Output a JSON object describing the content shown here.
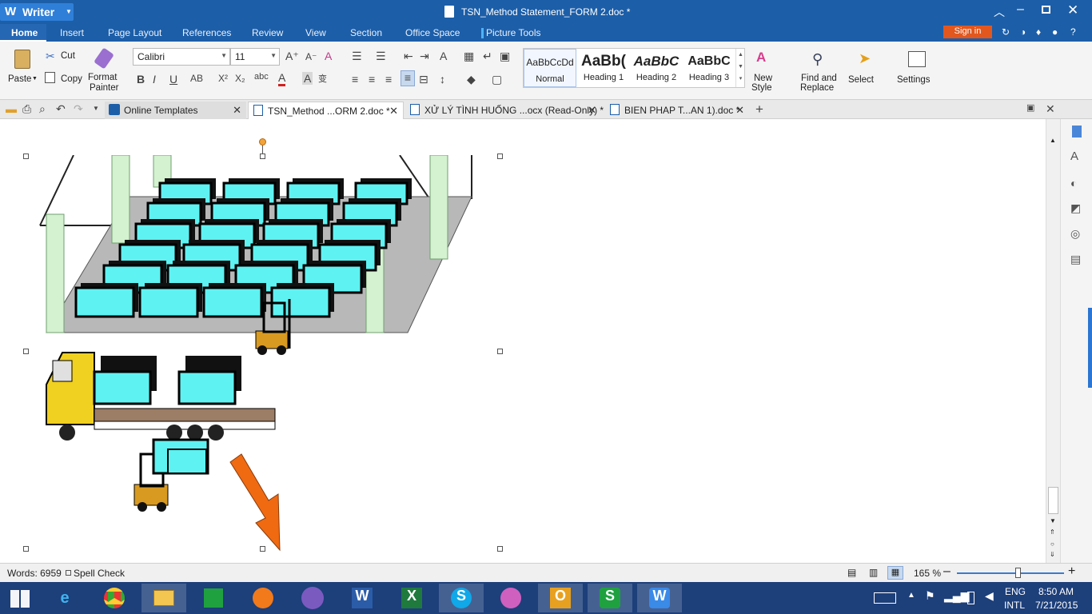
{
  "app": {
    "name": "Writer",
    "window_title": "TSN_Method Statement_FORM 2.doc *",
    "sign_in": "Sign in",
    "help": "?"
  },
  "menu": [
    "Home",
    "Insert",
    "Page Layout",
    "References",
    "Review",
    "View",
    "Section",
    "Office Space",
    "Picture Tools"
  ],
  "ribbon": {
    "paste": "Paste",
    "cut": "Cut",
    "copy": "Copy",
    "format_painter_1": "Format",
    "format_painter_2": "Painter",
    "font_name": "Calibri",
    "font_size": "11",
    "styles": [
      {
        "preview": "AaBbCcDd",
        "name": "Normal"
      },
      {
        "preview": "AaBb(",
        "name": "Heading 1"
      },
      {
        "preview": "AaBbC",
        "name": "Heading 2"
      },
      {
        "preview": "AaBbC",
        "name": "Heading 3"
      }
    ],
    "new_style_1": "New",
    "new_style_2": "Style",
    "find_replace_1": "Find and",
    "find_replace_2": "Replace",
    "select": "Select",
    "settings": "Settings"
  },
  "tabs": [
    {
      "label": "Online Templates"
    },
    {
      "label": "TSN_Method ...ORM 2.doc *"
    },
    {
      "label": "XỬ LÝ TÌNH HUỐNG ...ocx (Read-Only) *"
    },
    {
      "label": "BIEN PHAP T...AN 1).doc *"
    }
  ],
  "status": {
    "words": "Words: 6959",
    "spell_check": "Spell Check",
    "zoom": "165 %"
  },
  "taskbar": {
    "lang_1": "ENG",
    "lang_2": "INTL",
    "time": "8:50 AM",
    "date": "7/21/2015"
  },
  "colors": {
    "accent": "#1c5ea8",
    "signin": "#e2571e",
    "arrow": "#f06a12",
    "screen": "#5ef2f2",
    "forklift": "#d89a20",
    "truck_cab": "#f0d020"
  }
}
